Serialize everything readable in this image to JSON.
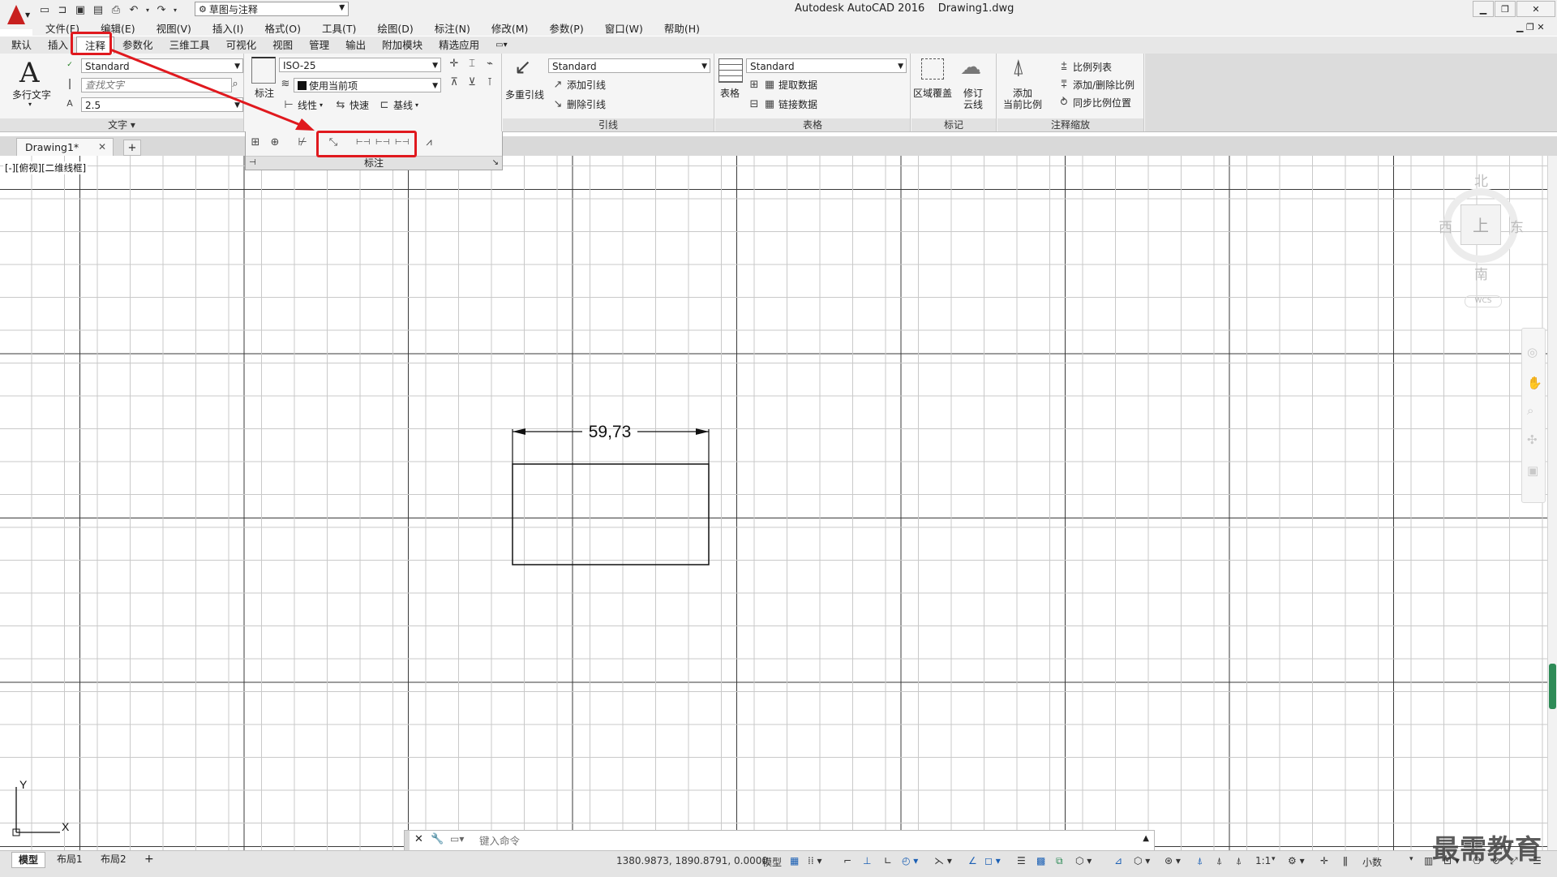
{
  "title": {
    "app": "Autodesk AutoCAD 2016",
    "file": "Drawing1.dwg"
  },
  "qat": {
    "workspace": "草图与注释"
  },
  "menu": [
    "文件(F)",
    "编辑(E)",
    "视图(V)",
    "插入(I)",
    "格式(O)",
    "工具(T)",
    "绘图(D)",
    "标注(N)",
    "修改(M)",
    "参数(P)",
    "窗口(W)",
    "帮助(H)"
  ],
  "ribbon_tabs": [
    "默认",
    "插入",
    "注释",
    "参数化",
    "三维工具",
    "可视化",
    "视图",
    "管理",
    "输出",
    "附加模块",
    "精选应用"
  ],
  "text_panel": {
    "title": "文字",
    "mtext_label": "多行文字",
    "style": "Standard",
    "find_placeholder": "查找文字",
    "height": "2.5"
  },
  "dim_panel": {
    "title": "标注",
    "big_label": "标注",
    "style": "ISO-25",
    "layer": "使用当前项",
    "linear": "线性",
    "quick": "快速",
    "baseline": "基线"
  },
  "leader_panel": {
    "title": "引线",
    "big_label": "多重引线",
    "style": "Standard",
    "add": "添加引线",
    "remove": "删除引线"
  },
  "table_panel": {
    "title": "表格",
    "big_label": "表格",
    "style": "Standard",
    "extract": "提取数据",
    "link": "链接数据"
  },
  "mark_panel": {
    "title": "标记",
    "wipeout": "区域覆盖",
    "revcloud_line1": "修订",
    "revcloud_line2": "云线"
  },
  "scale_panel": {
    "title": "注释缩放",
    "add_line1": "添加",
    "add_line2": "当前比例",
    "scale_list": "比例列表",
    "add_delete": "添加/删除比例",
    "sync": "同步比例位置"
  },
  "doc_tab": "Drawing1*",
  "viewport_label": "[-][俯视][二维线框]",
  "viewcube": {
    "north": "北",
    "south": "南",
    "east": "东",
    "west": "西",
    "top": "上",
    "wcs": "WCS"
  },
  "drawing": {
    "dimension_text": "59,73"
  },
  "ucs": {
    "x": "X",
    "y": "Y"
  },
  "command": {
    "placeholder": "键入命令"
  },
  "layout_tabs": [
    "模型",
    "布局1",
    "布局2"
  ],
  "status": {
    "coords": "1380.9873, 1890.8791, 0.0000",
    "model": "模型",
    "scale": "1:1",
    "units": "小数"
  },
  "watermark": "最需教育",
  "colors": {
    "highlight": "#e0191e",
    "logo": "#c8201f"
  }
}
